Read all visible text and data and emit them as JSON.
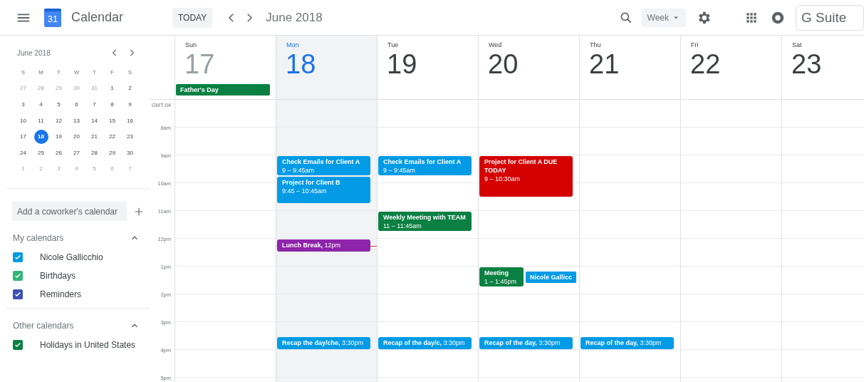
{
  "header": {
    "logo_day": "31",
    "app_name": "Calendar",
    "today_button": "TODAY",
    "period": "June 2018",
    "view_selector": "Week",
    "brand_badge": "G Suite"
  },
  "sidebar": {
    "mini_calendar": {
      "title": "June 2018",
      "weekdays": [
        "S",
        "M",
        "T",
        "W",
        "T",
        "F",
        "S"
      ],
      "weeks": [
        {
          "days": [
            {
              "label": "27",
              "muted": true,
              "selected": false
            },
            {
              "label": "28",
              "muted": true,
              "selected": false
            },
            {
              "label": "29",
              "muted": true,
              "selected": false
            },
            {
              "label": "30",
              "muted": true,
              "selected": false
            },
            {
              "label": "31",
              "muted": true,
              "selected": false
            },
            {
              "label": "1",
              "muted": false,
              "selected": false
            },
            {
              "label": "2",
              "muted": false,
              "selected": false
            }
          ]
        },
        {
          "days": [
            {
              "label": "3",
              "muted": false,
              "selected": false
            },
            {
              "label": "4",
              "muted": false,
              "selected": false
            },
            {
              "label": "5",
              "muted": false,
              "selected": false
            },
            {
              "label": "6",
              "muted": false,
              "selected": false
            },
            {
              "label": "7",
              "muted": false,
              "selected": false
            },
            {
              "label": "8",
              "muted": false,
              "selected": false
            },
            {
              "label": "9",
              "muted": false,
              "selected": false
            }
          ]
        },
        {
          "days": [
            {
              "label": "10",
              "muted": false,
              "selected": false
            },
            {
              "label": "11",
              "muted": false,
              "selected": false
            },
            {
              "label": "12",
              "muted": false,
              "selected": false
            },
            {
              "label": "13",
              "muted": false,
              "selected": false
            },
            {
              "label": "14",
              "muted": false,
              "selected": false
            },
            {
              "label": "15",
              "muted": false,
              "selected": false
            },
            {
              "label": "16",
              "muted": false,
              "selected": false
            }
          ]
        },
        {
          "days": [
            {
              "label": "17",
              "muted": false,
              "selected": false
            },
            {
              "label": "18",
              "muted": false,
              "selected": true
            },
            {
              "label": "19",
              "muted": false,
              "selected": false
            },
            {
              "label": "20",
              "muted": false,
              "selected": false
            },
            {
              "label": "21",
              "muted": false,
              "selected": false
            },
            {
              "label": "22",
              "muted": false,
              "selected": false
            },
            {
              "label": "23",
              "muted": false,
              "selected": false
            }
          ]
        },
        {
          "days": [
            {
              "label": "24",
              "muted": false,
              "selected": false
            },
            {
              "label": "25",
              "muted": false,
              "selected": false
            },
            {
              "label": "26",
              "muted": false,
              "selected": false
            },
            {
              "label": "27",
              "muted": false,
              "selected": false
            },
            {
              "label": "28",
              "muted": false,
              "selected": false
            },
            {
              "label": "29",
              "muted": false,
              "selected": false
            },
            {
              "label": "30",
              "muted": false,
              "selected": false
            }
          ]
        },
        {
          "days": [
            {
              "label": "1",
              "muted": true,
              "selected": false
            },
            {
              "label": "2",
              "muted": true,
              "selected": false
            },
            {
              "label": "3",
              "muted": true,
              "selected": false
            },
            {
              "label": "4",
              "muted": true,
              "selected": false
            },
            {
              "label": "5",
              "muted": true,
              "selected": false
            },
            {
              "label": "6",
              "muted": true,
              "selected": false
            },
            {
              "label": "7",
              "muted": true,
              "selected": false
            }
          ]
        }
      ]
    },
    "coworker_field": {
      "placeholder": "Add a coworker's calendar"
    },
    "sections": [
      {
        "title": "My calendars",
        "expanded": true,
        "items": [
          {
            "name": "Nicole Gallicchio",
            "checked": true,
            "color": "#039be5"
          },
          {
            "name": "Birthdays",
            "checked": true,
            "color": "#33b679"
          },
          {
            "name": "Reminders",
            "checked": true,
            "color": "#3f51b5"
          }
        ]
      },
      {
        "title": "Other calendars",
        "expanded": true,
        "items": [
          {
            "name": "Holidays in United States",
            "checked": true,
            "color": "#0b8043"
          }
        ]
      }
    ]
  },
  "week": {
    "timezone": "GMT-04",
    "time_labels": [
      "8am",
      "9am",
      "10am",
      "11am",
      "12pm",
      "1pm",
      "2pm",
      "3pm",
      "4pm",
      "5pm"
    ],
    "days": [
      {
        "weekday": "Sun",
        "date": "17",
        "selected": false,
        "past": true,
        "all_day": [
          {
            "title": "Father's Day",
            "color": "#0b8043"
          }
        ]
      },
      {
        "weekday": "Mon",
        "date": "18",
        "selected": true,
        "past": false,
        "events": [
          {
            "kind": "block",
            "title": "Check Emails for Client A",
            "time": "9 – 9:45am",
            "color": "#039be5"
          },
          {
            "kind": "block",
            "title": "Project for Client B",
            "time": "9:45 – 10:45am",
            "color": "#039be5"
          },
          {
            "kind": "compact",
            "title": "Lunch Break,",
            "time": "12pm",
            "color": "#8e24aa"
          },
          {
            "kind": "compact",
            "title": "Recap the day/che,",
            "time": "3:30pm",
            "color": "#039be5"
          }
        ]
      },
      {
        "weekday": "Tue",
        "date": "19",
        "selected": false,
        "past": false,
        "events": [
          {
            "kind": "block",
            "title": "Check Emails for Client A",
            "time": "9 – 9:45am",
            "color": "#039be5"
          },
          {
            "kind": "block",
            "title": "Weekly Meeting with TEAM",
            "time": "11 – 11:45am",
            "color": "#0b8043"
          },
          {
            "kind": "compact",
            "title": "Recap of the day/c,",
            "time": "3:30pm",
            "color": "#039be5"
          }
        ]
      },
      {
        "weekday": "Wed",
        "date": "20",
        "selected": false,
        "past": false,
        "events": [
          {
            "kind": "block",
            "title": "Project for Client A DUE TODAY",
            "time": "9 – 10:30am",
            "color": "#d50000"
          },
          {
            "kind": "block",
            "title": "Meeting",
            "time": "1 – 1:45pm",
            "color": "#0b8043"
          },
          {
            "kind": "overlap",
            "title": "Nicole Gallicc",
            "color": "#039be5"
          },
          {
            "kind": "compact",
            "title": "Recap of the day,",
            "time": "3:30pm",
            "color": "#039be5"
          }
        ]
      },
      {
        "weekday": "Thu",
        "date": "21",
        "selected": false,
        "past": false,
        "events": [
          {
            "kind": "compact",
            "title": "Recap of the day,",
            "time": "3:30pm",
            "color": "#039be5"
          }
        ]
      },
      {
        "weekday": "Fri",
        "date": "22",
        "selected": false,
        "past": false
      },
      {
        "weekday": "Sat",
        "date": "23",
        "selected": false,
        "past": false
      }
    ]
  }
}
